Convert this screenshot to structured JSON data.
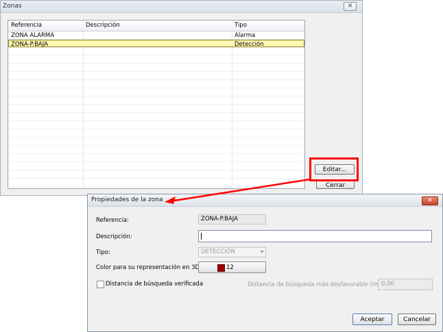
{
  "zonas_window": {
    "title": "Zonas",
    "close_label": "✕",
    "columns": [
      "Referencia",
      "Descripción",
      "Tipo"
    ],
    "rows": [
      {
        "referencia": "ZONA ALARMA",
        "descripcion": "",
        "tipo": "Alarma"
      },
      {
        "referencia": "ZONA-P.BAJA",
        "descripcion": "",
        "tipo": "Detección"
      }
    ],
    "editar_label": "Editar...",
    "cerrar_label": "Cerrar"
  },
  "props_dialog": {
    "title": "Propiedades de la zona",
    "close_label": "✕",
    "referencia_label": "Referencia:",
    "referencia_value": "ZONA-P.BAJA",
    "descripcion_label": "Descripción:",
    "descripcion_value": "",
    "tipo_label": "Tipo:",
    "tipo_value": "DETECCIÓN",
    "color_label": "Color para su representación en 3D:",
    "color_value": "12",
    "color_hex": "#a00000",
    "distancia_check_label": "Distancia de búsqueda verificada",
    "distancia_label": "Distancia de búsqueda más desfavorable (m):",
    "distancia_value": "0,00",
    "aceptar_label": "Aceptar",
    "cancelar_label": "Cancelar"
  },
  "annotation": {
    "highlight_color": "#ff0000"
  }
}
